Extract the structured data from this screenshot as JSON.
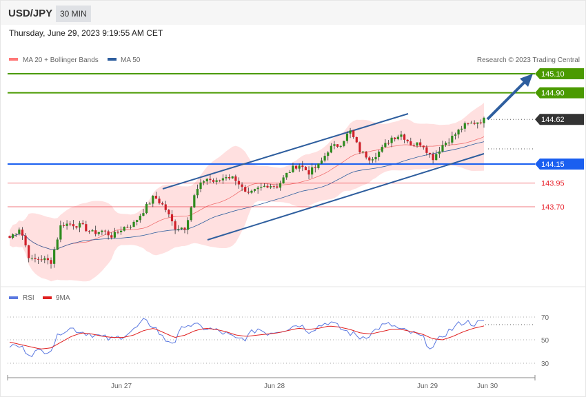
{
  "header": {
    "symbol": "USD/JPY",
    "timeframe": "30 MIN",
    "datetime": "Thursday, June 29, 2023 9:19:55 AM CET"
  },
  "legend": {
    "ma20": "MA 20 + Bollinger Bands",
    "ma50": "MA 50",
    "copyright": "Research © 2023 Trading Central",
    "rsi": "RSI",
    "rsi_ma": "9MA"
  },
  "levels": [
    {
      "price": 145.1,
      "label": "145.10",
      "color": "#4a9a00",
      "style": "tag"
    },
    {
      "price": 144.9,
      "label": "144.90",
      "color": "#4a9a00",
      "style": "tag"
    },
    {
      "price": 144.62,
      "label": "144.62",
      "color": "#333333",
      "style": "tag-dotted"
    },
    {
      "price": 144.15,
      "label": "144.15",
      "color": "#1a5ff0",
      "style": "tag"
    },
    {
      "price": 143.95,
      "label": "143.95",
      "color": "#e8202a",
      "style": "text"
    },
    {
      "price": 143.7,
      "label": "143.70",
      "color": "#e8202a",
      "style": "text"
    }
  ],
  "rsi_axis": {
    "labels": [
      "70",
      "50",
      "30"
    ]
  },
  "xaxis": {
    "labels": [
      "Jun 27",
      "Jun 28",
      "Jun 29",
      "Jun 30"
    ]
  },
  "chart_data": {
    "type": "candlestick",
    "closes_keypoints": [
      143.374,
      143.483,
      143.135,
      143.157,
      143.12,
      143.519,
      143.519,
      143.497,
      143.425,
      143.447,
      143.389,
      143.483,
      143.519,
      143.664,
      143.809,
      143.7,
      143.483,
      143.483,
      143.845,
      144.005,
      143.954,
      144.027,
      143.991,
      143.809,
      143.882,
      143.932,
      143.918,
      144.063,
      144.15,
      144.063,
      144.136,
      144.317,
      144.353,
      144.498,
      144.281,
      144.208,
      144.295,
      144.426,
      144.462,
      144.353,
      144.368,
      144.208,
      144.353,
      144.44,
      144.549,
      144.585,
      144.614
    ],
    "rsi_keypoints": [
      45,
      44,
      38,
      40,
      42,
      58,
      60,
      57,
      55,
      52,
      50,
      54,
      58,
      66,
      62,
      50,
      48,
      64,
      62,
      60,
      58,
      55,
      50,
      52,
      60,
      56,
      58,
      60,
      64,
      58,
      62,
      66,
      60,
      56,
      52,
      55,
      62,
      63,
      58,
      56,
      52,
      42,
      54,
      60,
      66,
      64,
      65
    ],
    "rsi_ma_keypoints": [
      48,
      46,
      44,
      42,
      43,
      48,
      53,
      56,
      55,
      53,
      52,
      52,
      54,
      58,
      60,
      56,
      52,
      54,
      58,
      60,
      59,
      57,
      54,
      53,
      54,
      55,
      56,
      58,
      60,
      59,
      60,
      62,
      61,
      59,
      56,
      55,
      57,
      59,
      59,
      57,
      55,
      51,
      50,
      53,
      57,
      60,
      62
    ]
  },
  "colors": {
    "bull": "#2e8b1e",
    "bear": "#d0202a",
    "band": "#ffe0e0",
    "ma20": "#f07070",
    "ma50": "#2e5e9e",
    "rsi": "#5a78e0",
    "rsi_ma": "#e02020"
  }
}
